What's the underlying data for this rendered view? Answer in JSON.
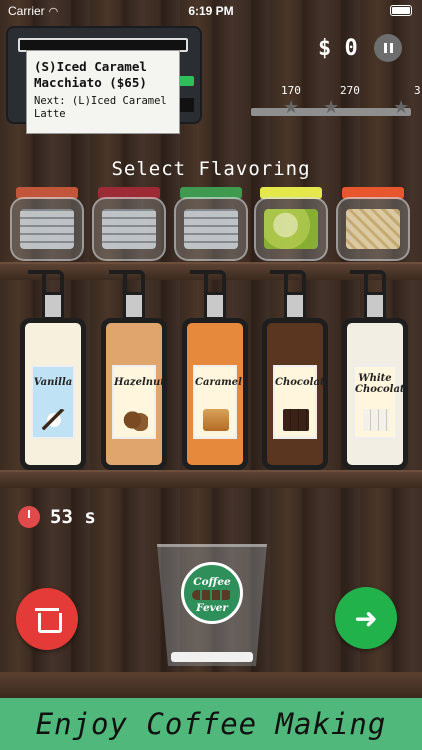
{
  "status_bar": {
    "carrier": "Carrier",
    "time": "6:19 PM"
  },
  "order": {
    "current": "(S)Iced Caramel Macchiato ($65)",
    "next": "Next: (L)Iced Caramel Latte"
  },
  "money": "$ 0",
  "progress": {
    "milestones": [
      "170",
      "270",
      "3"
    ],
    "value_fraction": 0
  },
  "section_title": "Select Flavoring",
  "jars": [
    {
      "name": "ice-cubes-1",
      "lid_color": "#c2563a"
    },
    {
      "name": "ice-cubes-2",
      "lid_color": "#9c2b35"
    },
    {
      "name": "ice-cubes-3",
      "lid_color": "#3e9a4e"
    },
    {
      "name": "lime-slices",
      "lid_color": "#e5e84a"
    },
    {
      "name": "noodles",
      "lid_color": "#e8562e"
    }
  ],
  "syrups": [
    {
      "label": "Vanilla",
      "fill": "#f6f0dc",
      "icon": "vanilla-icon"
    },
    {
      "label": "Hazelnut",
      "fill": "#e0a56c",
      "icon": "hazelnut-icon"
    },
    {
      "label": "Caramel",
      "fill": "#e6893c",
      "icon": "caramel-icon"
    },
    {
      "label": "Chocolate",
      "fill": "#5a3520",
      "icon": "chocolate-icon"
    },
    {
      "label": "White Chocolate",
      "fill": "#f2eee4",
      "icon": "white-chocolate-icon"
    }
  ],
  "timer": "53 s",
  "cup_badge": {
    "line1": "Coffee",
    "line2": "Fever"
  },
  "banner": "Enjoy Coffee Making",
  "colors": {
    "trash_button": "#e43b38",
    "next_button": "#22b24c",
    "banner": "#4fb87a"
  }
}
